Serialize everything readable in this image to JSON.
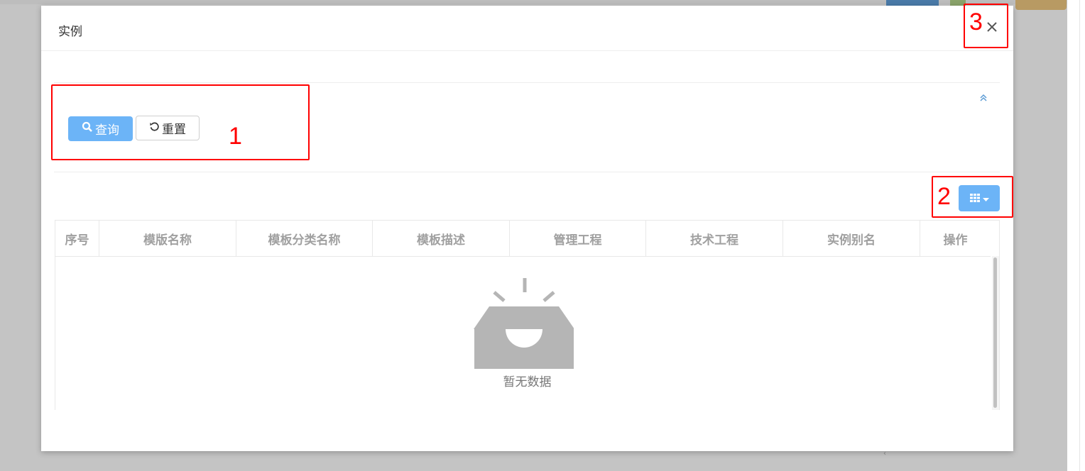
{
  "modal": {
    "title": "实例",
    "close_icon": "close-icon"
  },
  "search_panel": {
    "query_label": "查询",
    "query_icon": "search-icon",
    "reset_label": "重置",
    "reset_icon": "refresh-icon",
    "collapse_icon": "double-chevron-up-icon"
  },
  "toolbar": {
    "columns_icon": "grid-icon",
    "dropdown_icon": "caret-down-icon"
  },
  "table": {
    "columns": [
      "序号",
      "模版名称",
      "模板分类名称",
      "模板描述",
      "管理工程",
      "技术工程",
      "实例别名",
      "操作"
    ],
    "rows": [],
    "empty_text": "暂无数据",
    "empty_icon": "empty-inbox-icon"
  },
  "annotations": [
    "1",
    "2",
    "3"
  ],
  "colors": {
    "primary": "#6cb4f7",
    "annotation": "#ff0000",
    "backdrop": "#c4c4c4"
  }
}
